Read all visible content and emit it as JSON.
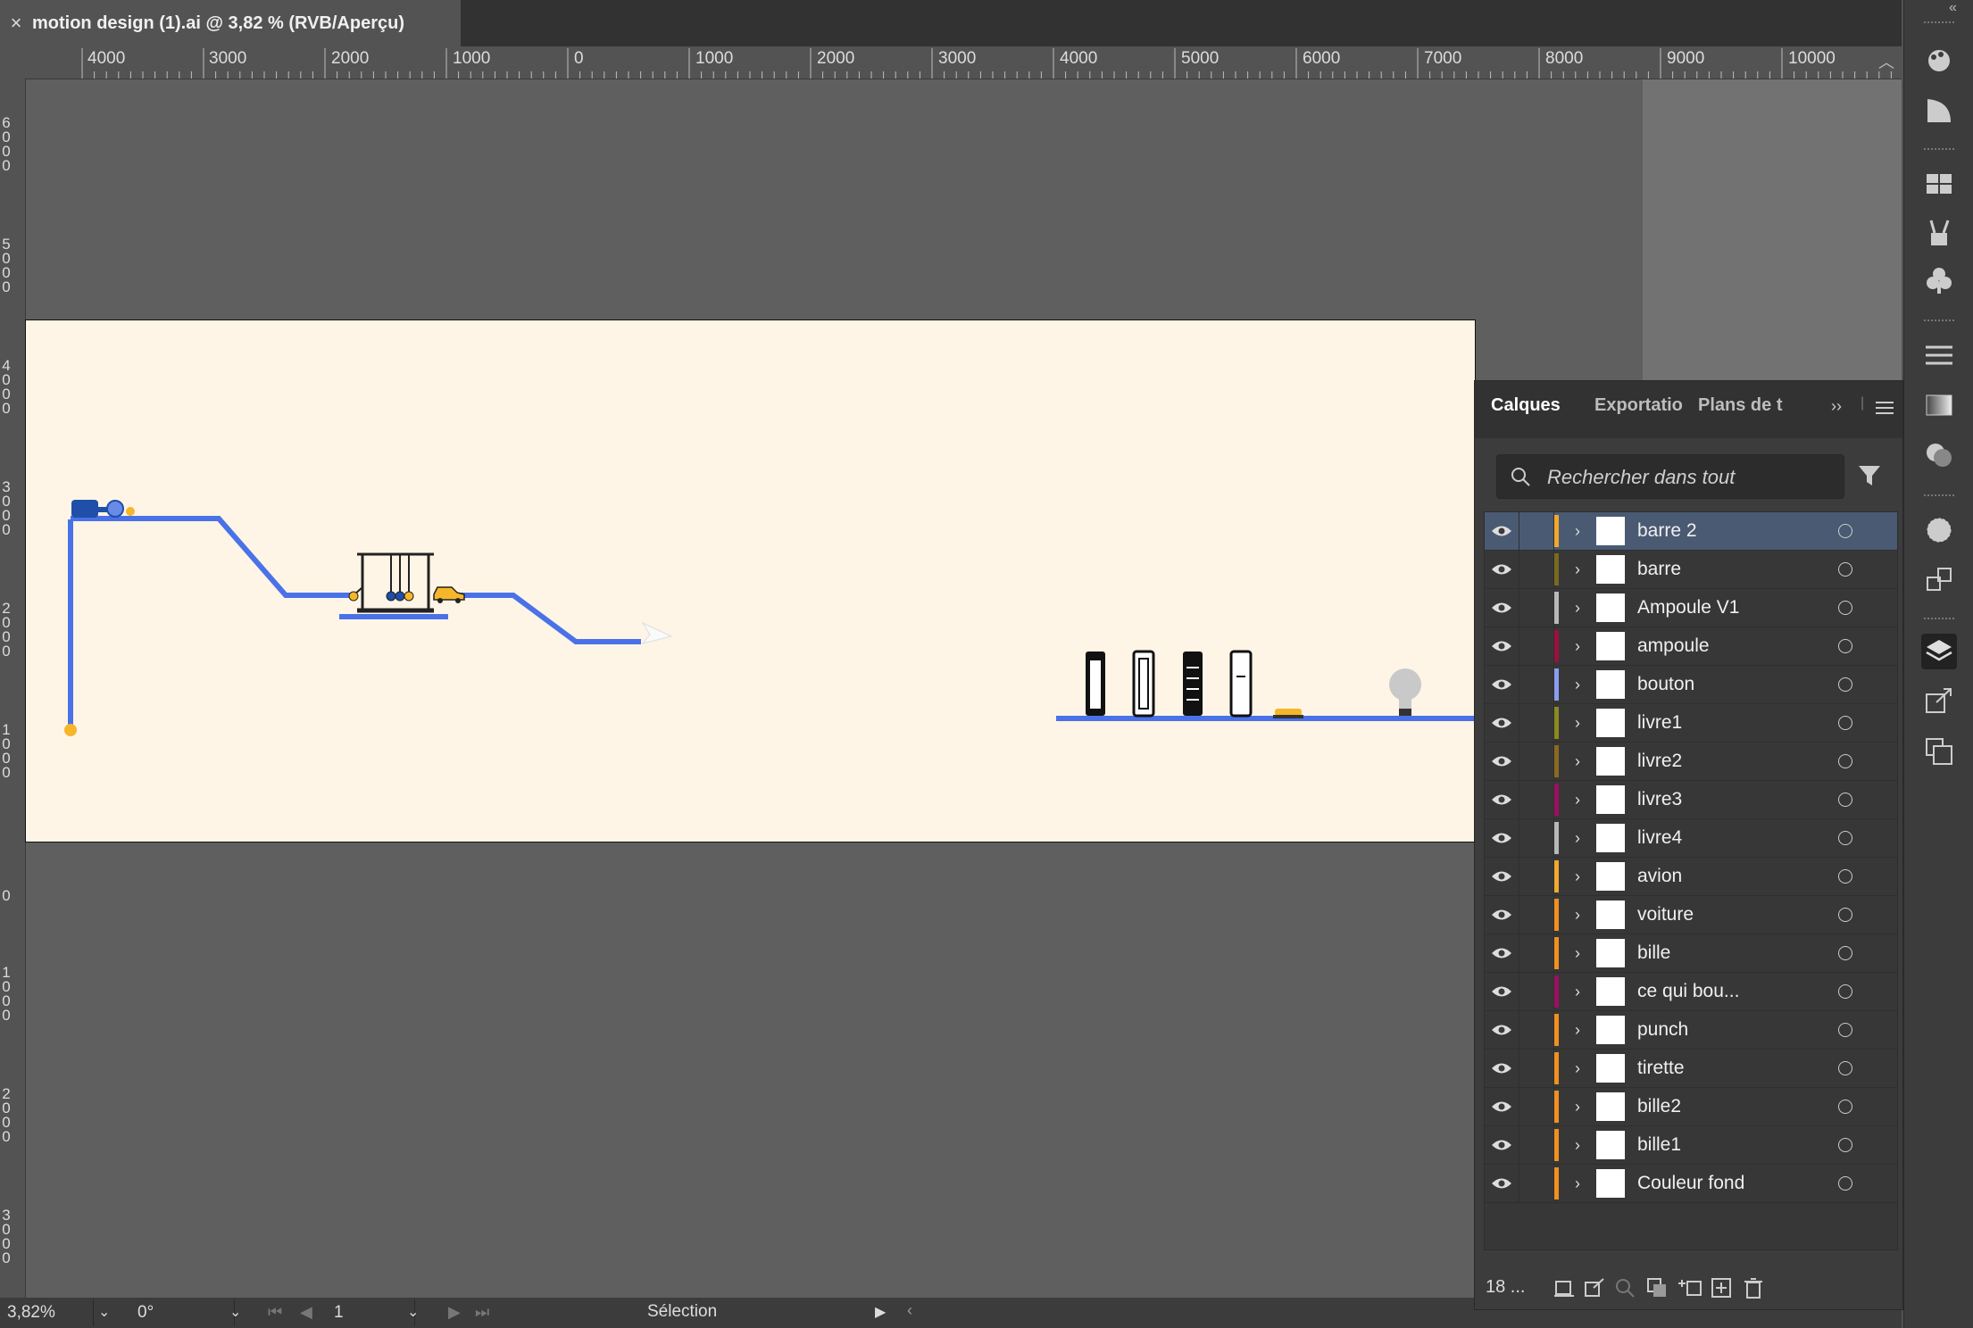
{
  "document": {
    "title": "motion design (1).ai @ 3,82 % (RVB/Aperçu)",
    "close_label": "×"
  },
  "ruler": {
    "top_labels": [
      "4000",
      "3000",
      "2000",
      "1000",
      "0",
      "1000",
      "2000",
      "3000",
      "4000",
      "5000",
      "6000",
      "7000",
      "8000",
      "9000",
      "10000"
    ],
    "left_labels": [
      "6\n0\n0\n0",
      "5\n0\n0\n0",
      "4\n0\n0\n0",
      "3\n0\n0\n0",
      "2\n0\n0\n0",
      "1\n0\n0\n0",
      "0",
      "1\n0\n0\n0",
      "2\n0\n0\n0",
      "3\n0\n0\n0"
    ]
  },
  "status": {
    "zoom": "3,82%",
    "rotation": "0°",
    "artboard": "1",
    "tool": "Sélection"
  },
  "layers_panel": {
    "tabs": [
      "Calques",
      "Exportatio",
      "Plans de t"
    ],
    "active_tab": "Calques",
    "search_placeholder": "Rechercher dans tout",
    "footer_count": "18 ...",
    "layers": [
      {
        "name": "barre 2",
        "color": "#f0a830",
        "selected": true
      },
      {
        "name": "barre",
        "color": "#7a6a20"
      },
      {
        "name": "Ampoule V1",
        "color": "#b8b8b8"
      },
      {
        "name": "ampoule",
        "color": "#9a1040"
      },
      {
        "name": "bouton",
        "color": "#8a9ef0"
      },
      {
        "name": "livre1",
        "color": "#8a8a20"
      },
      {
        "name": "livre2",
        "color": "#8a6a20"
      },
      {
        "name": "livre3",
        "color": "#9a1060"
      },
      {
        "name": "livre4",
        "color": "#b8b8b8"
      },
      {
        "name": "avion",
        "color": "#f0a830"
      },
      {
        "name": "voiture",
        "color": "#f09020"
      },
      {
        "name": "bille",
        "color": "#f09020"
      },
      {
        "name": "ce qui bou...",
        "color": "#9a1060"
      },
      {
        "name": "punch",
        "color": "#f09020"
      },
      {
        "name": "tirette",
        "color": "#f09020"
      },
      {
        "name": "bille2",
        "color": "#f09020"
      },
      {
        "name": "bille1",
        "color": "#f09020"
      },
      {
        "name": "Couleur fond",
        "color": "#f09020"
      }
    ]
  },
  "artwork": {
    "background": "#fff5e6",
    "line_color": "#4a72e8",
    "accent": "#f5b62a"
  }
}
